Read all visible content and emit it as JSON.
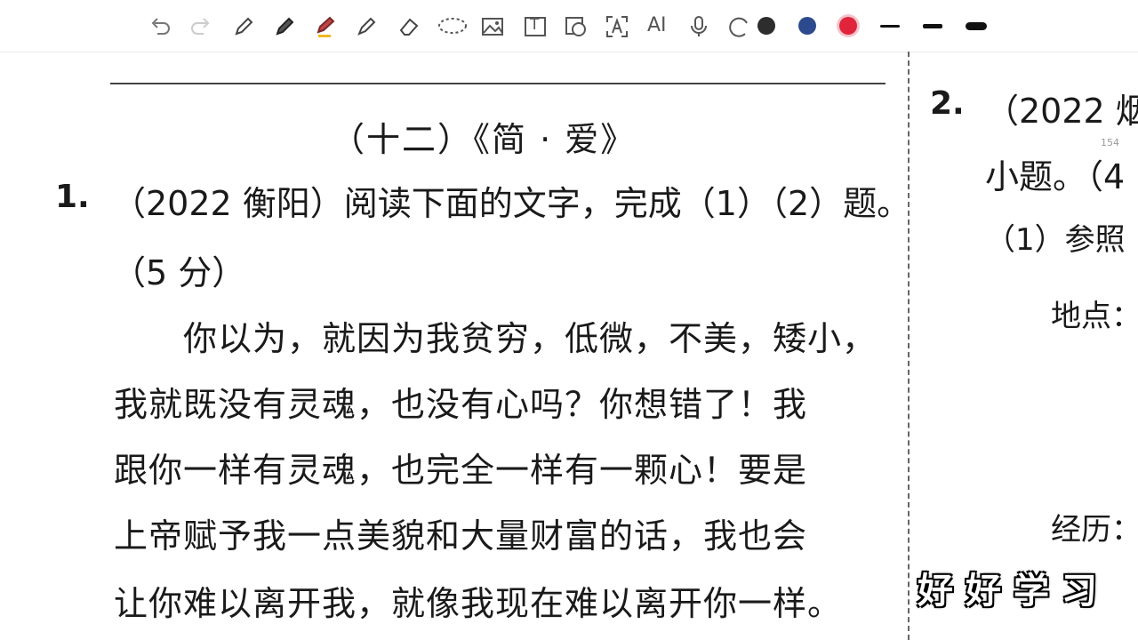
{
  "toolbar": {
    "text_tool": "T",
    "ai_label": "AI",
    "colors": [
      "#2d2d2d",
      "#2e4a8f",
      "#e0243b"
    ],
    "icons": [
      "undo-icon",
      "redo-icon",
      "pencil-icon",
      "pen-icon",
      "highlighter-icon",
      "marker-icon",
      "eraser-icon",
      "lasso-icon",
      "image-icon",
      "text-box-icon",
      "shape-icon",
      "ocr-text-icon",
      "ai-icon",
      "microphone-icon",
      "more-icon"
    ]
  },
  "left_page": {
    "section_title": "（十二）《简 · 爱》",
    "question1": {
      "number": "1.",
      "stem": "（2022 衡阳）阅读下面的文字，完成（1）（2）题。",
      "score": "（5 分）",
      "passage": [
        "　　你以为，就因为我贫穷，低微，不美，矮小，",
        "我就既没有灵魂，也没有心吗？你想错了！我",
        "跟你一样有灵魂，也完全一样有一颗心！要是",
        "上帝赋予我一点美貌和大量财富的话，我也会",
        "让你难以离开我，就像我现在难以离开你一样。"
      ]
    }
  },
  "right_page": {
    "question2": {
      "number": "2.",
      "stem": "（2022 烟",
      "line2": "小题。（4",
      "sub1": "（1）参照",
      "place_label": "地点：",
      "experience_label": "经历："
    },
    "page_number": "154"
  },
  "watermark": "好好学习"
}
